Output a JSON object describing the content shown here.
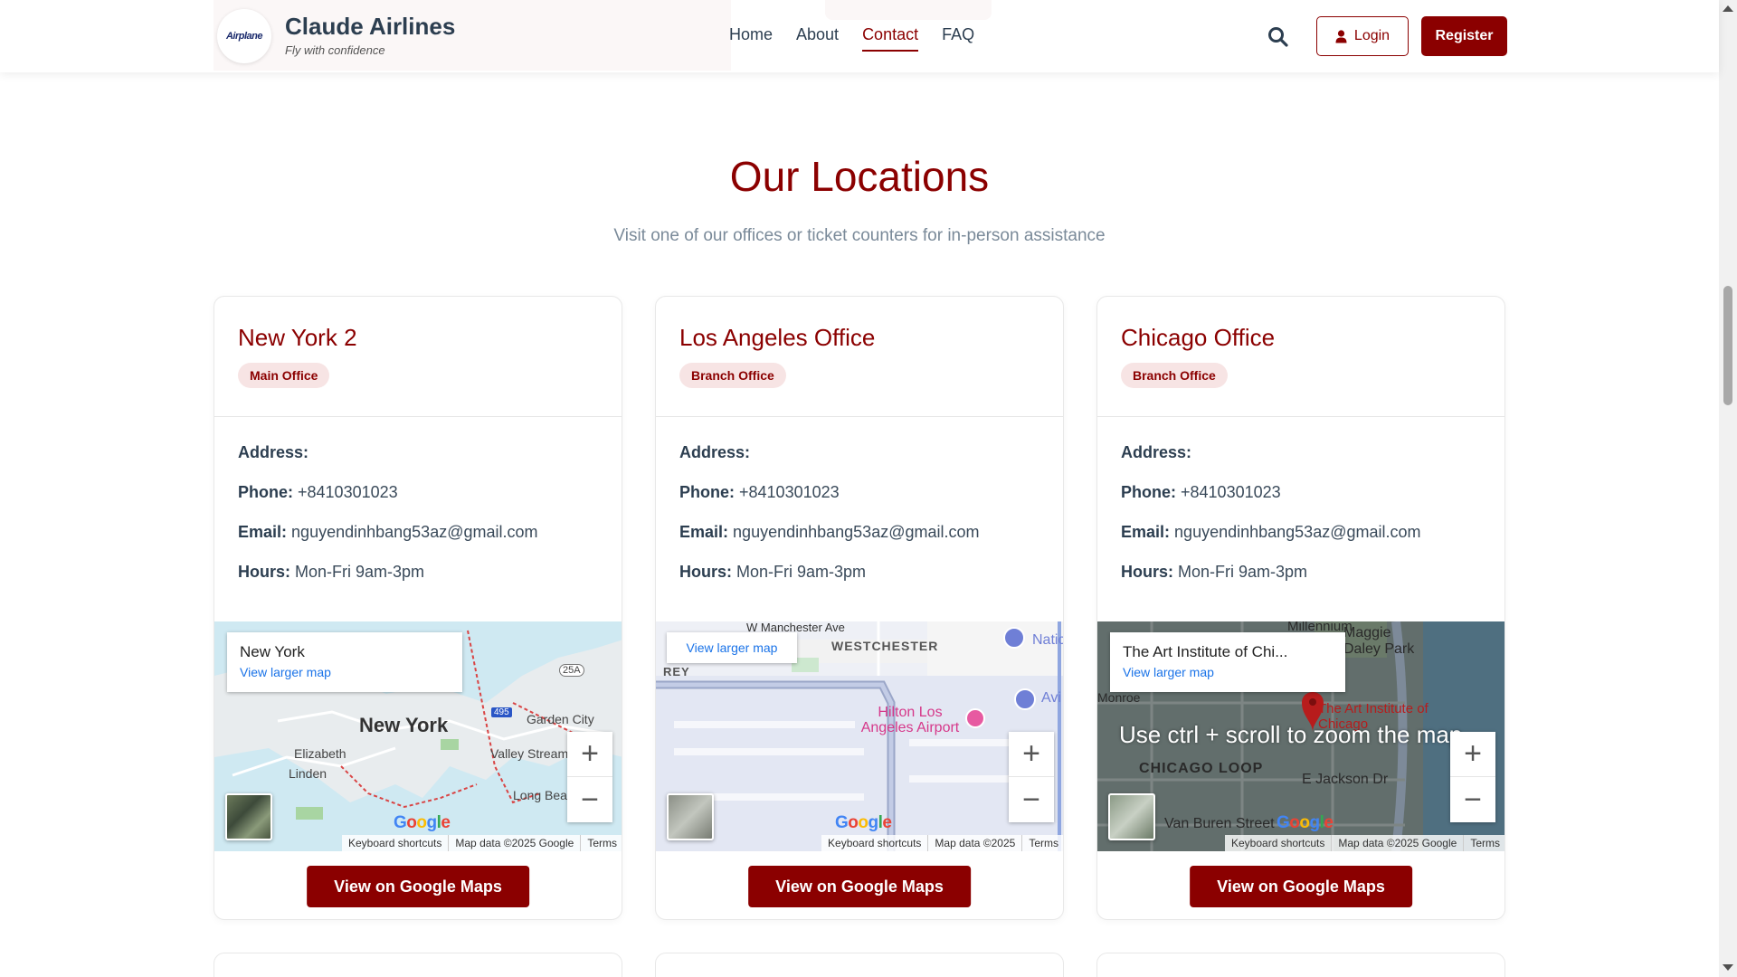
{
  "header": {
    "logo_text": "Airplane",
    "brand_title": "Claude Airlines",
    "brand_tagline": "Fly with confidence",
    "nav": [
      {
        "label": "Home"
      },
      {
        "label": "About"
      },
      {
        "label": "Contact"
      },
      {
        "label": "FAQ"
      }
    ],
    "active_nav": "Contact",
    "login_label": "Login",
    "register_label": "Register"
  },
  "section": {
    "title": "Our Locations",
    "subtitle": "Visit one of our offices or ticket counters for in-person assistance"
  },
  "labels": {
    "address": "Address:",
    "phone": "Phone:",
    "email": "Email:",
    "hours": "Hours:",
    "view_larger_map": "View larger map",
    "view_on_google_maps": "View on Google Maps",
    "keyboard_shortcuts": "Keyboard shortcuts",
    "terms": "Terms",
    "zoom_in": "+",
    "zoom_out": "−"
  },
  "locations": [
    {
      "name": "New York 2",
      "badge": "Main Office",
      "address": "",
      "phone": "+8410301023",
      "email": "nguyendinhbang53az@gmail.com",
      "hours": "Mon-Fri 9am-3pm",
      "map_place": "New York",
      "map_data": "Map data ©2025 Google",
      "map_labels": [
        "New York",
        "Elizabeth",
        "Linden",
        "Garden City",
        "Valley Stream",
        "Long Bea",
        "25A",
        "495"
      ]
    },
    {
      "name": "Los Angeles Office",
      "badge": "Branch Office",
      "address": "",
      "phone": "+8410301023",
      "email": "nguyendinhbang53az@gmail.com",
      "hours": "Mon-Fri 9am-3pm",
      "map_place": "",
      "map_data": "Map data ©2025",
      "map_labels": [
        "W Manchester Ave",
        "WESTCHESTER",
        "REY",
        "Hilton Los Angeles Airport",
        "Natic",
        "Avi"
      ]
    },
    {
      "name": "Chicago Office",
      "badge": "Branch Office",
      "address": "",
      "phone": "+8410301023",
      "email": "nguyendinhbang53az@gmail.com",
      "hours": "Mon-Fri 9am-3pm",
      "map_place": "The Art Institute of Chi...",
      "map_data": "Map data ©2025 Google",
      "map_overlay": "Use ctrl + scroll to zoom the map",
      "map_labels": [
        "Millennium",
        "Maggie Daley Park",
        "Monroe",
        "CHICAGO LOOP",
        "E Jackson Dr",
        "Van Buren Street",
        "The Art Institute of Chicago"
      ]
    }
  ],
  "colors": {
    "brand": "#8b0000",
    "badge_bg": "#f7e4e4",
    "text": "#2c3e50",
    "muted": "#7a8a99"
  }
}
